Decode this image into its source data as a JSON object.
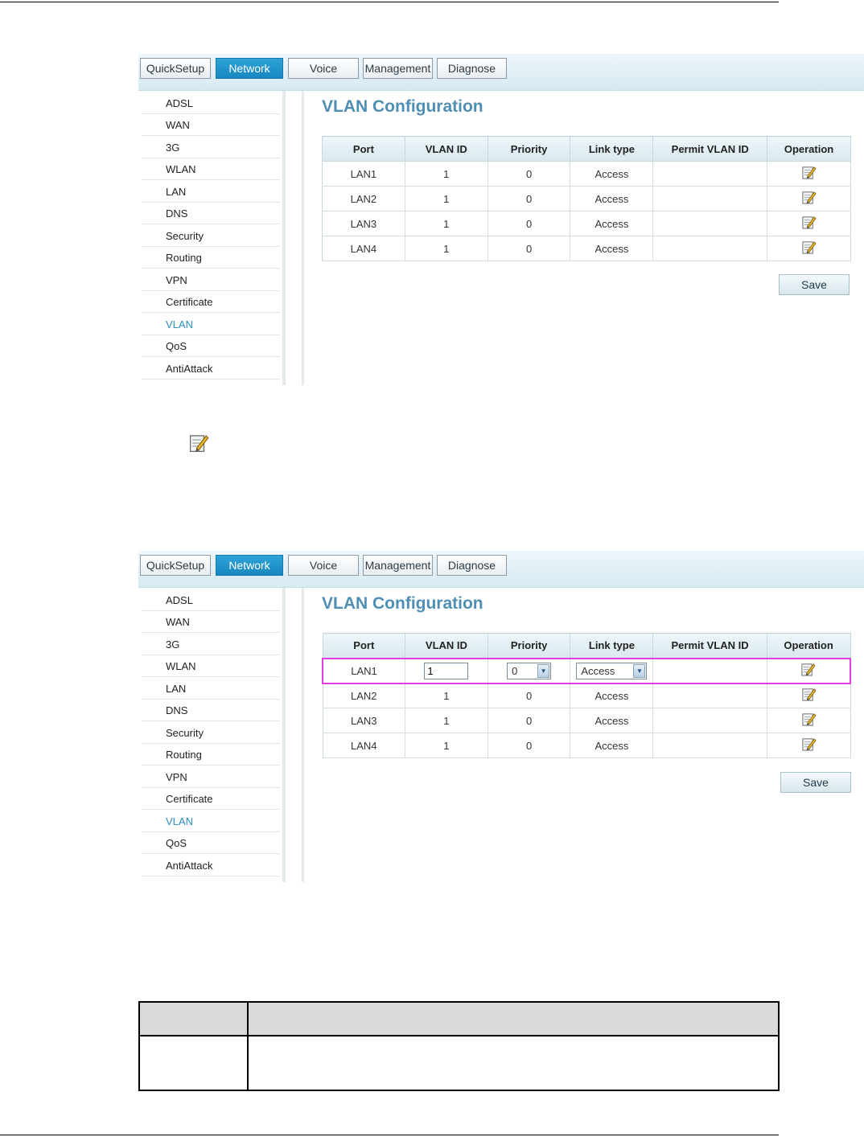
{
  "nav_tabs": [
    {
      "label": "QuickSetup",
      "active": false
    },
    {
      "label": "Network",
      "active": true
    },
    {
      "label": "Voice",
      "active": false
    },
    {
      "label": "Management",
      "active": false
    },
    {
      "label": "Diagnose",
      "active": false
    }
  ],
  "sidebar": [
    {
      "label": "ADSL"
    },
    {
      "label": "WAN"
    },
    {
      "label": "3G"
    },
    {
      "label": "WLAN"
    },
    {
      "label": "LAN"
    },
    {
      "label": "DNS"
    },
    {
      "label": "Security"
    },
    {
      "label": "Routing"
    },
    {
      "label": "VPN"
    },
    {
      "label": "Certificate"
    },
    {
      "label": "VLAN",
      "active": true
    },
    {
      "label": "QoS"
    },
    {
      "label": "AntiAttack"
    }
  ],
  "page_title": "VLAN Configuration",
  "columns": [
    "Port",
    "VLAN ID",
    "Priority",
    "Link type",
    "Permit VLAN ID",
    "Operation"
  ],
  "rows": [
    {
      "port": "LAN1",
      "vlan_id": "1",
      "priority": "0",
      "link_type": "Access",
      "permit": ""
    },
    {
      "port": "LAN2",
      "vlan_id": "1",
      "priority": "0",
      "link_type": "Access",
      "permit": ""
    },
    {
      "port": "LAN3",
      "vlan_id": "1",
      "priority": "0",
      "link_type": "Access",
      "permit": ""
    },
    {
      "port": "LAN4",
      "vlan_id": "1",
      "priority": "0",
      "link_type": "Access",
      "permit": ""
    }
  ],
  "edit_row": {
    "vlan_id": "1",
    "priority": "0",
    "link_type": "Access"
  },
  "save_label": "Save",
  "colors": {
    "accent": "#1787c0",
    "title": "#4f8fb4",
    "highlight": "#e33ce0"
  },
  "icons": {
    "edit": "edit-pencil-icon"
  }
}
